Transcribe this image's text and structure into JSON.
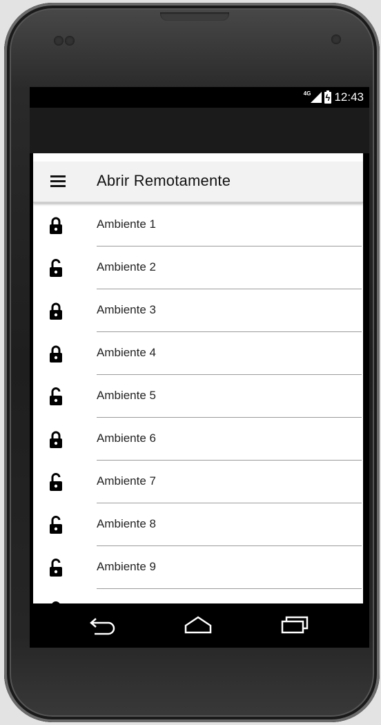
{
  "status_bar": {
    "network": "4G",
    "time": "12:43"
  },
  "app_bar": {
    "title": "Abrir Remotamente",
    "menu_icon": "hamburger-menu-icon"
  },
  "ambientes": [
    {
      "label": "Ambiente 1",
      "icon": "lock-closed-icon"
    },
    {
      "label": "Ambiente 2",
      "icon": "lock-open-icon"
    },
    {
      "label": "Ambiente 3",
      "icon": "lock-closed-icon"
    },
    {
      "label": "Ambiente 4",
      "icon": "lock-closed-icon"
    },
    {
      "label": "Ambiente 5",
      "icon": "lock-open-icon"
    },
    {
      "label": "Ambiente 6",
      "icon": "lock-closed-icon"
    },
    {
      "label": "Ambiente 7",
      "icon": "lock-open-icon"
    },
    {
      "label": "Ambiente 8",
      "icon": "lock-open-icon"
    },
    {
      "label": "Ambiente 9",
      "icon": "lock-open-icon"
    },
    {
      "label": "",
      "icon": "lock-open-icon"
    }
  ],
  "nav_bar": {
    "back_icon": "back-icon",
    "home_icon": "home-icon",
    "recents_icon": "recents-icon"
  }
}
